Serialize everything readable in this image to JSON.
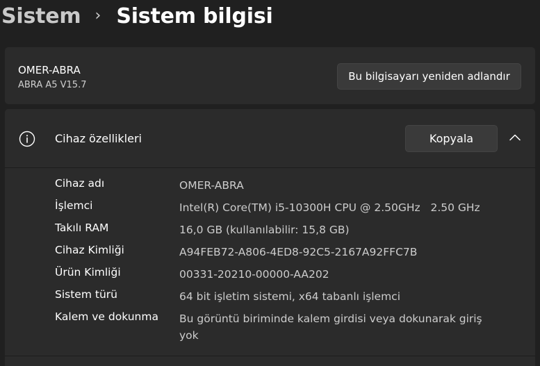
{
  "breadcrumb": {
    "parent": "Sistem",
    "separator": "›",
    "current": "Sistem bilgisi"
  },
  "device": {
    "name": "OMER-ABRA",
    "model": "ABRA A5 V15.7",
    "rename_button": "Bu bilgisayarı yeniden adlandır"
  },
  "specs": {
    "title": "Cihaz özellikleri",
    "icon": "info-icon",
    "copy_button": "Kopyala",
    "collapse_icon": "chevron-up-icon",
    "rows": [
      {
        "label": "Cihaz adı",
        "value": "OMER-ABRA"
      },
      {
        "label": "İşlemci",
        "value": "Intel(R) Core(TM) i5-10300H CPU @ 2.50GHz   2.50 GHz"
      },
      {
        "label": "Takılı RAM",
        "value": "16,0 GB (kullanılabilir: 15,8 GB)"
      },
      {
        "label": "Cihaz Kimliği",
        "value": "A94FEB72-A806-4ED8-92C5-2167A92FFC7B"
      },
      {
        "label": "Ürün Kimliği",
        "value": "00331-20210-00000-AA202"
      },
      {
        "label": "Sistem türü",
        "value": "64 bit işletim sistemi, x64 tabanlı işlemci"
      },
      {
        "label": "Kalem ve dokunma",
        "value": "Bu görüntü biriminde kalem girdisi veya dokunarak giriş yok"
      }
    ]
  },
  "colors": {
    "background": "#202020",
    "card": "#2b2b2b",
    "button": "#3a3a3a"
  }
}
